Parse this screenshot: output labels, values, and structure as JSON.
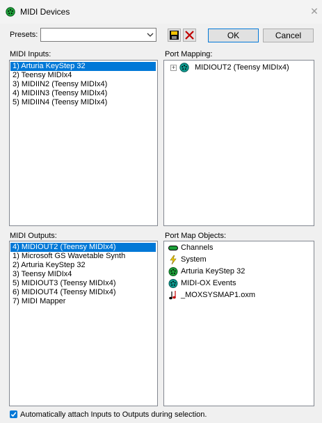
{
  "window": {
    "title": "MIDI Devices",
    "close_glyph": "✕"
  },
  "toolbar": {
    "presets_label": "Presets:",
    "presets_value": "",
    "ok_label": "OK",
    "cancel_label": "Cancel",
    "save_icon": "floppy-disk-icon",
    "delete_icon": "red-x-icon"
  },
  "midi_inputs": {
    "label": "MIDI Inputs:",
    "items": [
      "1) Arturia KeyStep 32",
      "2) Teensy MIDIx4",
      "3) MIDIIN2 (Teensy MIDIx4)",
      "4) MIDIIN3 (Teensy MIDIx4)",
      "5) MIDIIN4 (Teensy MIDIx4)"
    ],
    "selected_index": 0
  },
  "port_mapping": {
    "label": "Port Mapping:",
    "expand_glyph": "+",
    "node_label": "MIDIOUT2 (Teensy MIDIx4)"
  },
  "midi_outputs": {
    "label": "MIDI Outputs:",
    "items": [
      "4) MIDIOUT2 (Teensy MIDIx4)",
      "1) Microsoft GS Wavetable Synth",
      "2) Arturia KeyStep 32",
      "3) Teensy MIDIx4",
      "5) MIDIOUT3 (Teensy MIDIx4)",
      "6) MIDIOUT4 (Teensy MIDIx4)",
      "7) MIDI Mapper"
    ],
    "selected_index": 0
  },
  "port_map_objects": {
    "label": "Port Map Objects:",
    "items": [
      {
        "label": "Channels",
        "icon": "channels-icon"
      },
      {
        "label": "System",
        "icon": "lightning-icon"
      },
      {
        "label": "Arturia KeyStep 32",
        "icon": "green-port-icon"
      },
      {
        "label": "MIDI-OX Events",
        "icon": "teal-port-icon"
      },
      {
        "label": "_MOXSYSMAP1.oxm",
        "icon": "music-note-icon"
      }
    ]
  },
  "footer": {
    "auto_attach_label": "Automatically attach Inputs to Outputs during selection.",
    "auto_attach_checked": true
  },
  "colors": {
    "selection": "#0078d7",
    "green": "#1ea03a",
    "teal": "#0e9a8f"
  }
}
